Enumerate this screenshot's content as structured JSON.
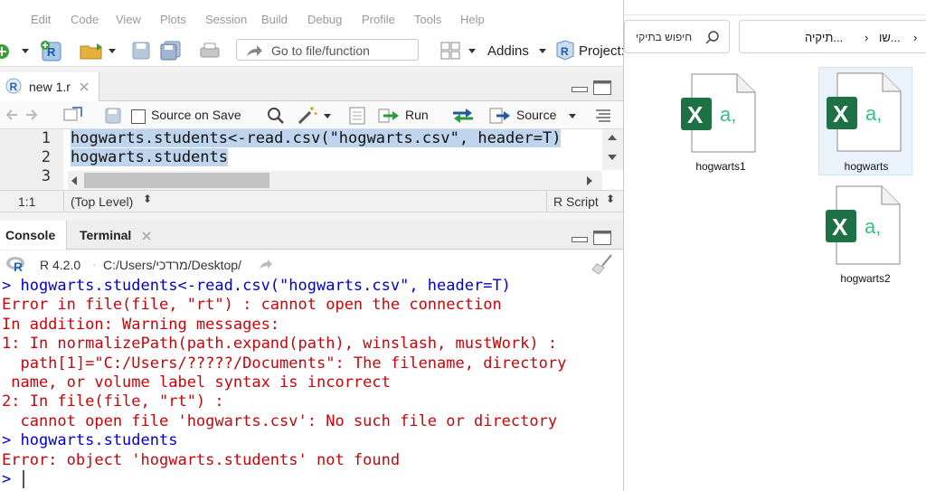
{
  "menu": [
    "Edit",
    "Code",
    "View",
    "Plots",
    "Session",
    "Build",
    "Debug",
    "Profile",
    "Tools",
    "Help"
  ],
  "toolbar": {
    "goto_label": "Go to file/function",
    "addins_label": "Addins",
    "project_label": "Project:"
  },
  "editor": {
    "tab_label": "new 1.r",
    "source_on_save_label": "Source on Save",
    "run_label": "Run",
    "source_label": "Source",
    "line_numbers": [
      "1",
      "2",
      "3"
    ],
    "lines": [
      "hogwarts.students<-read.csv(\"hogwarts.csv\", header=T)",
      "hogwarts.students"
    ],
    "status": {
      "position": "1:1",
      "scope": "(Top Level)",
      "type": "R Script"
    }
  },
  "console": {
    "tabs": [
      "Console",
      "Terminal"
    ],
    "r_version": "R 4.2.0",
    "path": "C:/Users/מרדכי/Desktop/",
    "lines": [
      {
        "kind": "cmd",
        "text": "> hogwarts.students<-read.csv(\"hogwarts.csv\", header=T)"
      },
      {
        "kind": "err",
        "text": "Error in file(file, \"rt\") : cannot open the connection"
      },
      {
        "kind": "err",
        "text": "In addition: Warning messages:"
      },
      {
        "kind": "err",
        "text": "1: In normalizePath(path.expand(path), winslash, mustWork) :"
      },
      {
        "kind": "err",
        "text": "  path[1]=\"C:/Users/?????/Documents\": The filename, directory"
      },
      {
        "kind": "err",
        "text": " name, or volume label syntax is incorrect"
      },
      {
        "kind": "err",
        "text": "2: In file(file, \"rt\") :"
      },
      {
        "kind": "err",
        "text": "  cannot open file 'hogwarts.csv': No such file or directory"
      },
      {
        "kind": "cmd",
        "text": "> hogwarts.students"
      },
      {
        "kind": "err",
        "text": "Error: object 'hogwarts.students' not found"
      },
      {
        "kind": "cmd",
        "text": ">"
      }
    ]
  },
  "explorer": {
    "search_placeholder": "חיפוש בתיקי",
    "address_parts": [
      "תיקיה...",
      "›",
      "שו...",
      "›"
    ],
    "files": [
      {
        "name": "hogwarts1",
        "selected": false
      },
      {
        "name": "hogwarts",
        "selected": true
      },
      {
        "name": "hogwarts2",
        "selected": false
      }
    ]
  },
  "colors": {
    "excel_green": "#1e7145",
    "excel_light": "#33c481",
    "console_cmd": "#0000cc",
    "console_error": "#c5060b",
    "selection": "#bfd5ee"
  }
}
